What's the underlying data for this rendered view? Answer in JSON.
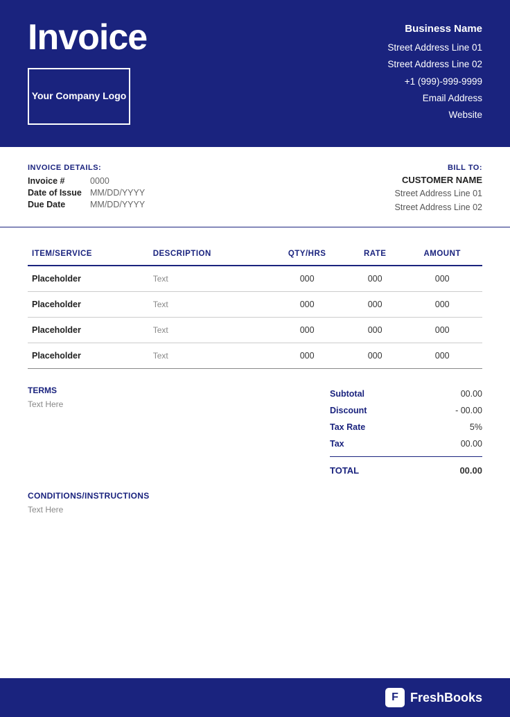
{
  "header": {
    "invoice_title": "Invoice",
    "logo_text": "Your Company Logo",
    "business_name": "Business Name",
    "address_line1": "Street Address Line 01",
    "address_line2": "Street Address Line 02",
    "phone": "+1 (999)-999-9999",
    "email": "Email Address",
    "website": "Website"
  },
  "invoice_details": {
    "section_label": "INVOICE DETAILS:",
    "invoice_num_label": "Invoice #",
    "invoice_num_value": "0000",
    "date_label": "Date of Issue",
    "date_value": "MM/DD/YYYY",
    "due_label": "Due Date",
    "due_value": "MM/DD/YYYY"
  },
  "bill_to": {
    "label": "BILL TO:",
    "customer_name": "CUSTOMER NAME",
    "address_line1": "Street Address Line 01",
    "address_line2": "Street Address Line 02"
  },
  "table": {
    "headers": {
      "item": "ITEM/SERVICE",
      "description": "DESCRIPTION",
      "qty": "QTY/HRS",
      "rate": "RATE",
      "amount": "AMOUNT"
    },
    "rows": [
      {
        "item": "Placeholder",
        "description": "Text",
        "qty": "000",
        "rate": "000",
        "amount": "000"
      },
      {
        "item": "Placeholder",
        "description": "Text",
        "qty": "000",
        "rate": "000",
        "amount": "000"
      },
      {
        "item": "Placeholder",
        "description": "Text",
        "qty": "000",
        "rate": "000",
        "amount": "000"
      },
      {
        "item": "Placeholder",
        "description": "Text",
        "qty": "000",
        "rate": "000",
        "amount": "000"
      }
    ]
  },
  "terms": {
    "label": "TERMS",
    "text": "Text Here"
  },
  "totals": {
    "subtotal_label": "Subtotal",
    "subtotal_value": "00.00",
    "discount_label": "Discount",
    "discount_value": "- 00.00",
    "taxrate_label": "Tax Rate",
    "taxrate_value": "5%",
    "tax_label": "Tax",
    "tax_value": "00.00",
    "total_label": "TOTAL",
    "total_value": "00.00"
  },
  "conditions": {
    "label": "CONDITIONS/INSTRUCTIONS",
    "text": "Text Here"
  },
  "footer": {
    "brand_icon": "F",
    "brand_name": "FreshBooks"
  }
}
